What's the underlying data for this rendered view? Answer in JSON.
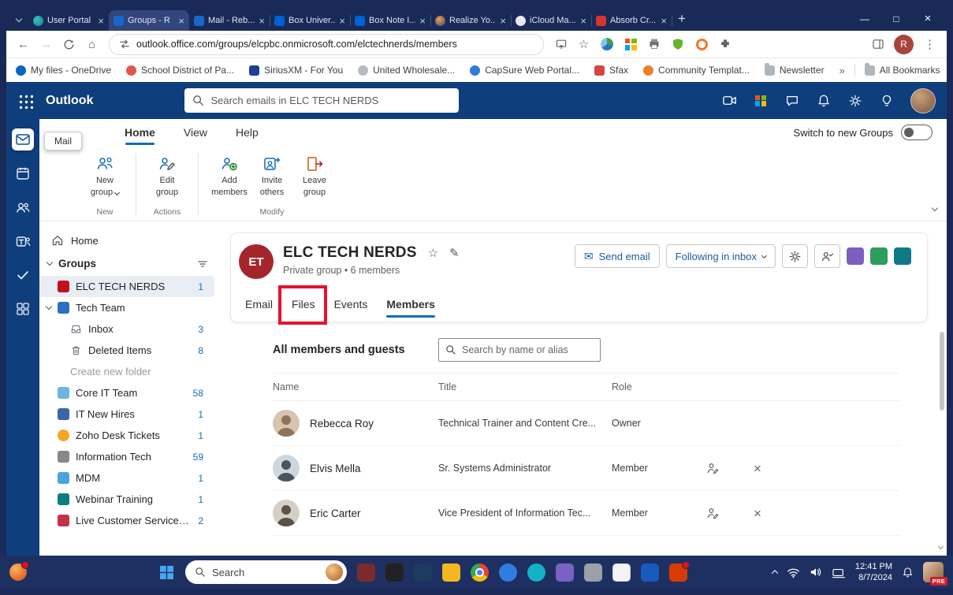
{
  "colors": {
    "browser_frame": "#1a2a58",
    "outlook_header": "#0f3e7c",
    "accent_blue": "#0f6cbd",
    "annotation_red": "#e8112d",
    "group_avatar_red": "#a4262c"
  },
  "browser": {
    "tab_titles": [
      "User Portal",
      "Groups - R",
      "Mail - Reb...",
      "Box Univer...",
      "Box Note I...",
      "Realize Yo...",
      "iCloud Ma...",
      "Absorb Cr..."
    ],
    "url": "outlook.office.com/groups/elcpbc.onmicrosoft.com/elctechnerds/members",
    "profile_initial": "R",
    "bookmarks": [
      "My files - OneDrive",
      "School District of Pa...",
      "SiriusXM - For You",
      "United Wholesale...",
      "CapSure Web Portal...",
      "Sfax",
      "Community Templat...",
      "Newsletter"
    ],
    "bookmarks_overflow": "»",
    "all_bookmarks_label": "All Bookmarks"
  },
  "outlook": {
    "app_name": "Outlook",
    "search_placeholder": "Search emails in ELC TECH NERDS",
    "rail_tooltip": "Mail",
    "ribbon_tabs": {
      "home": "Home",
      "view": "View",
      "help": "Help"
    },
    "switch_label": "Switch to new Groups",
    "ribbon_buttons": [
      {
        "line1": "New",
        "line2": "group"
      },
      {
        "line1": "Edit",
        "line2": "group"
      },
      {
        "line1": "Add",
        "line2": "members"
      },
      {
        "line1": "Invite",
        "line2": "others"
      },
      {
        "line1": "Leave",
        "line2": "group"
      }
    ],
    "ribbon_group_labels": [
      "New",
      "Actions",
      "Modify"
    ]
  },
  "sidebar": {
    "home_label": "Home",
    "groups_label": "Groups",
    "items": [
      {
        "label": "ELC TECH NERDS",
        "count": "1"
      },
      {
        "label": "Tech Team"
      },
      {
        "label": "Inbox",
        "count": "3"
      },
      {
        "label": "Deleted Items",
        "count": "8"
      },
      {
        "label": "Create new folder"
      },
      {
        "label": "Core IT Team",
        "count": "58"
      },
      {
        "label": "IT New Hires",
        "count": "1"
      },
      {
        "label": "Zoho Desk Tickets",
        "count": "1"
      },
      {
        "label": "Information Tech",
        "count": "59"
      },
      {
        "label": "MDM",
        "count": "1"
      },
      {
        "label": "Webinar Training",
        "count": "1"
      },
      {
        "label": "Live Customer Service Chat",
        "count": "2"
      }
    ]
  },
  "group": {
    "avatar_initials": "ET",
    "name": "ELC TECH NERDS",
    "subtitle": "Private group • 6 members",
    "send_email_label": "Send email",
    "following_label": "Following in inbox",
    "tabs": [
      "Email",
      "Files",
      "Events",
      "Members"
    ],
    "active_tab": "Members"
  },
  "members": {
    "heading": "All members and guests",
    "search_placeholder": "Search by name or alias",
    "columns": [
      "Name",
      "Title",
      "Role"
    ],
    "rows": [
      {
        "name": "Rebecca Roy",
        "title": "Technical Trainer and Content Cre...",
        "role": "Owner"
      },
      {
        "name": "Elvis Mella",
        "title": "Sr. Systems Administrator",
        "role": "Member"
      },
      {
        "name": "Eric Carter",
        "title": "Vice President of Information Tec...",
        "role": "Member"
      }
    ]
  },
  "taskbar": {
    "search_label": "Search",
    "clock_time": "12:41 PM",
    "clock_date": "8/7/2024",
    "badge": "PRE"
  }
}
